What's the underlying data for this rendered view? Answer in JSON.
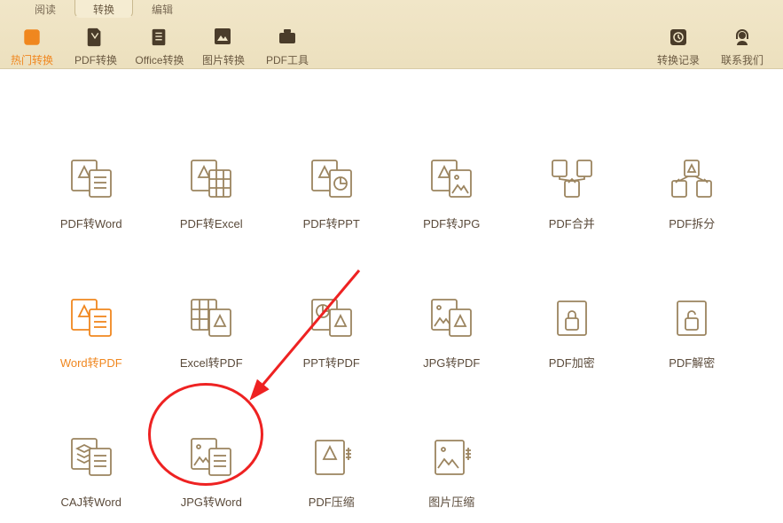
{
  "tabs": [
    "阅读",
    "转换",
    "编辑"
  ],
  "activeTab": 1,
  "toolbar": [
    {
      "id": "hot",
      "label": "热门转换"
    },
    {
      "id": "pdf",
      "label": "PDF转换"
    },
    {
      "id": "office",
      "label": "Office转换"
    },
    {
      "id": "img",
      "label": "图片转换"
    },
    {
      "id": "tools",
      "label": "PDF工具"
    }
  ],
  "activeTool": 0,
  "toolbarRight": [
    {
      "id": "history",
      "label": "转换记录"
    },
    {
      "id": "contact",
      "label": "联系我们"
    }
  ],
  "items": [
    {
      "id": "pdf2word",
      "label": "PDF转Word",
      "icon": "doc-pair"
    },
    {
      "id": "pdf2excel",
      "label": "PDF转Excel",
      "icon": "doc-grid"
    },
    {
      "id": "pdf2ppt",
      "label": "PDF转PPT",
      "icon": "doc-chart"
    },
    {
      "id": "pdf2jpg",
      "label": "PDF转JPG",
      "icon": "doc-img"
    },
    {
      "id": "pdfmerge",
      "label": "PDF合并",
      "icon": "merge"
    },
    {
      "id": "pdfsplit",
      "label": "PDF拆分",
      "icon": "split"
    },
    {
      "id": "word2pdf",
      "label": "Word转PDF",
      "icon": "doc-pair",
      "highlight": true
    },
    {
      "id": "excel2pdf",
      "label": "Excel转PDF",
      "icon": "grid-doc"
    },
    {
      "id": "ppt2pdf",
      "label": "PPT转PDF",
      "icon": "chart-doc"
    },
    {
      "id": "jpg2pdf",
      "label": "JPG转PDF",
      "icon": "img-doc"
    },
    {
      "id": "pdfencrypt",
      "label": "PDF加密",
      "icon": "lock"
    },
    {
      "id": "pdfdecrypt",
      "label": "PDF解密",
      "icon": "unlock"
    },
    {
      "id": "caj2word",
      "label": "CAJ转Word",
      "icon": "layers-doc"
    },
    {
      "id": "jpg2word",
      "label": "JPG转Word",
      "icon": "img-lines"
    },
    {
      "id": "pdfcompress",
      "label": "PDF压缩",
      "icon": "doc-compress"
    },
    {
      "id": "imgcompress",
      "label": "图片压缩",
      "icon": "img-compress"
    }
  ]
}
